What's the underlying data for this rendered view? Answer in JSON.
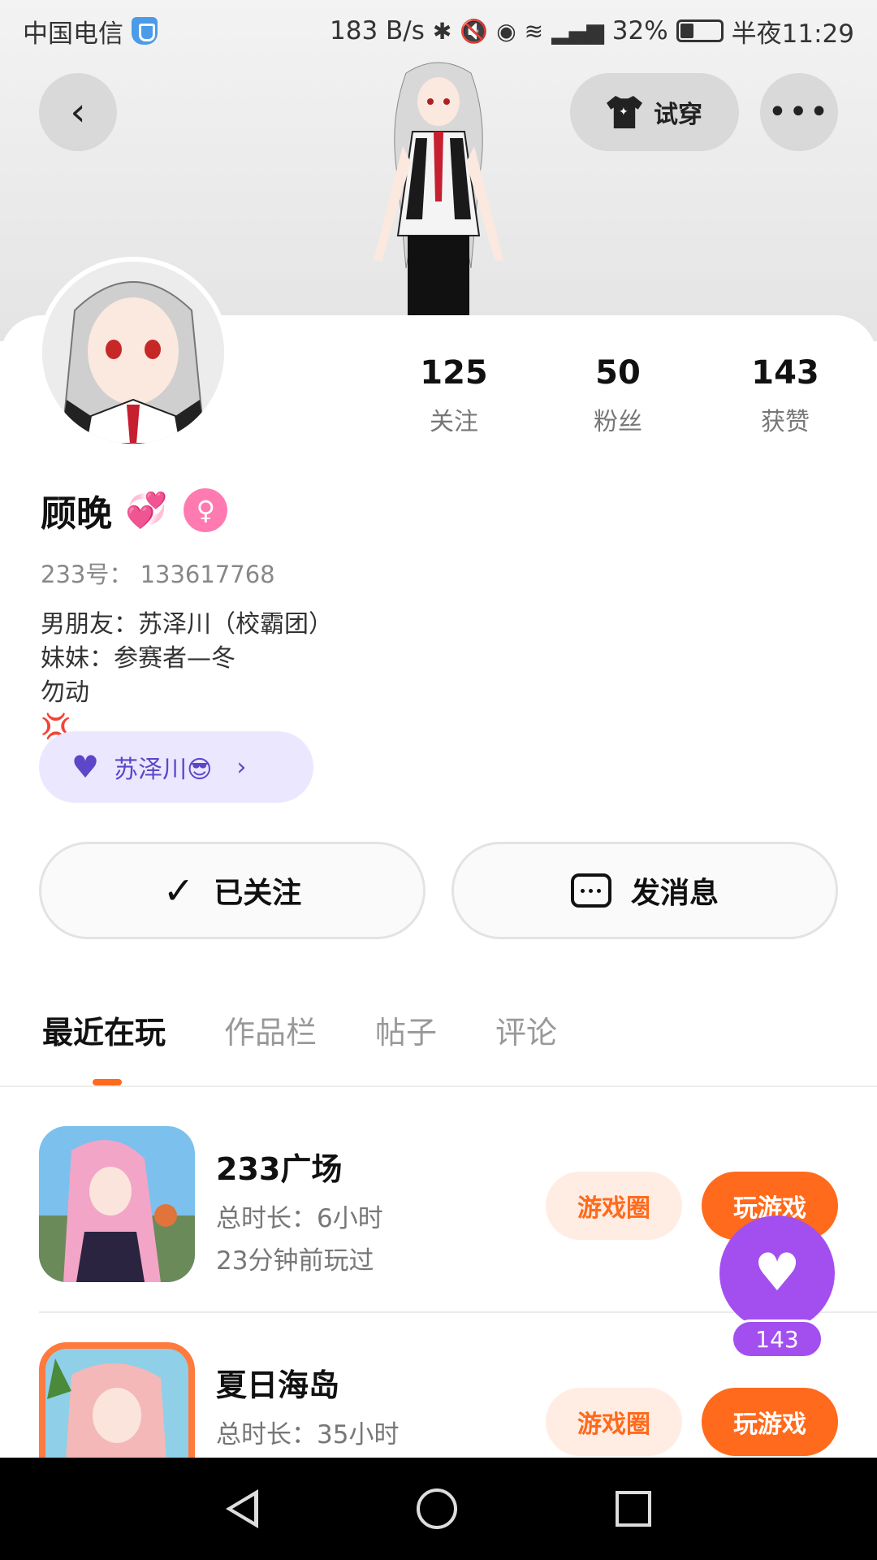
{
  "status_bar": {
    "carrier": "中国电信",
    "speed": "183 B/s",
    "battery": "32%",
    "time": "半夜11:29"
  },
  "header": {
    "try_on_label": "试穿",
    "back_icon": "back-chevron-icon",
    "more_icon": "more-dots-icon"
  },
  "profile": {
    "stats": [
      {
        "value": "125",
        "label": "关注"
      },
      {
        "value": "50",
        "label": "粉丝"
      },
      {
        "value": "143",
        "label": "获赞"
      }
    ],
    "name": "顾晚",
    "name_emoji": "💞",
    "gender_icon": "female-icon",
    "uid": "233号： 133617768",
    "bio": [
      "男朋友：苏泽川（校霸团）",
      "妹妹：参赛者—冬",
      "勿动"
    ],
    "bio_emoji": "💢",
    "partner": {
      "name": "苏泽川😎",
      "icon": "heart-icon"
    }
  },
  "actions": {
    "follow_label": "已关注",
    "message_label": "发消息"
  },
  "tabs": [
    "最近在玩",
    "作品栏",
    "帖子",
    "评论"
  ],
  "games": [
    {
      "title": "233广场",
      "total_time": "总时长：6小时",
      "last_played": "23分钟前玩过",
      "circle_label": "游戏圈",
      "play_label": "玩游戏"
    },
    {
      "title": "夏日海岛",
      "total_time": "总时长：35小时",
      "last_played": "",
      "circle_label": "游戏圈",
      "play_label": "玩游戏"
    }
  ],
  "floating_like": {
    "count": "143"
  },
  "colors": {
    "accent_orange": "#ff6a1c",
    "accent_purple": "#a34ff0",
    "partner_bg": "#ebe7ff"
  }
}
